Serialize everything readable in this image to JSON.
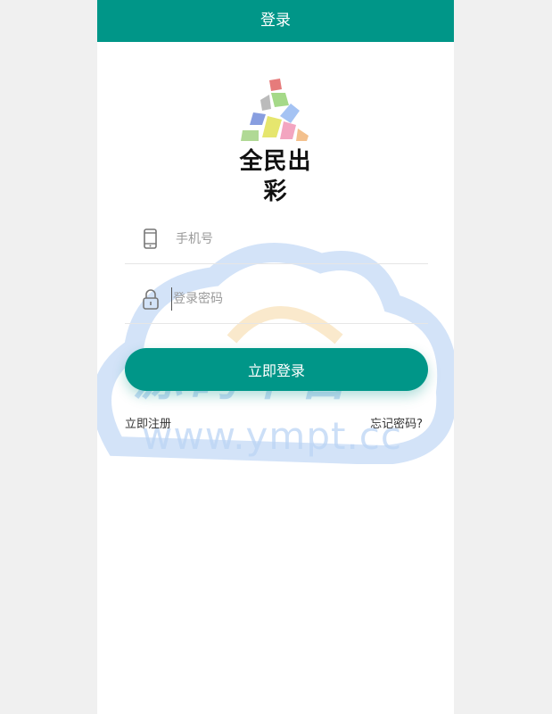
{
  "header": {
    "title": "登录"
  },
  "brand": {
    "name": "全民出彩"
  },
  "form": {
    "phone_placeholder": "手机号",
    "password_placeholder": "登录密码",
    "login_label": "立即登录"
  },
  "links": {
    "register": "立即注册",
    "forgot": "忘记密码?"
  },
  "watermark": {
    "title": "源码平台",
    "url": "www.ympt.cc"
  },
  "colors": {
    "accent": "#009688",
    "background": "#f0f0f0"
  }
}
